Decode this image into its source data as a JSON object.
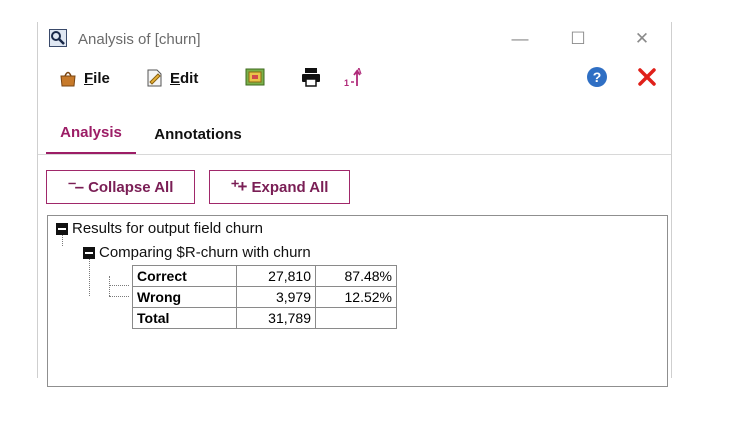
{
  "window": {
    "title": "Analysis of [churn]"
  },
  "window_controls": {
    "minimize": "—",
    "maximize": "☐",
    "close": "✕"
  },
  "menu": {
    "file": {
      "label": "File",
      "underline": "F",
      "rest": "ile"
    },
    "edit": {
      "label": "Edit",
      "underline": "E",
      "rest": "dit"
    }
  },
  "toolbar_icons": [
    "export-icon",
    "print-icon",
    "sort-icon",
    "help-icon",
    "close-red-icon"
  ],
  "tabs": [
    {
      "label": "Analysis",
      "active": true
    },
    {
      "label": "Annotations",
      "active": false
    }
  ],
  "buttons": {
    "collapse_all": "Collapse All",
    "expand_all": "Expand All"
  },
  "tree": {
    "root_label": "Results for output field churn",
    "child_label": "Comparing $R-churn with churn",
    "rows": [
      {
        "label": "Correct",
        "count": "27,810",
        "pct": "87.48%"
      },
      {
        "label": "Wrong",
        "count": "3,979",
        "pct": "12.52%"
      },
      {
        "label": "Total",
        "count": "31,789",
        "pct": ""
      }
    ]
  },
  "colors": {
    "accent": "#9c1d66",
    "close_red": "#e0201a",
    "help_blue": "#2f6fc4"
  }
}
